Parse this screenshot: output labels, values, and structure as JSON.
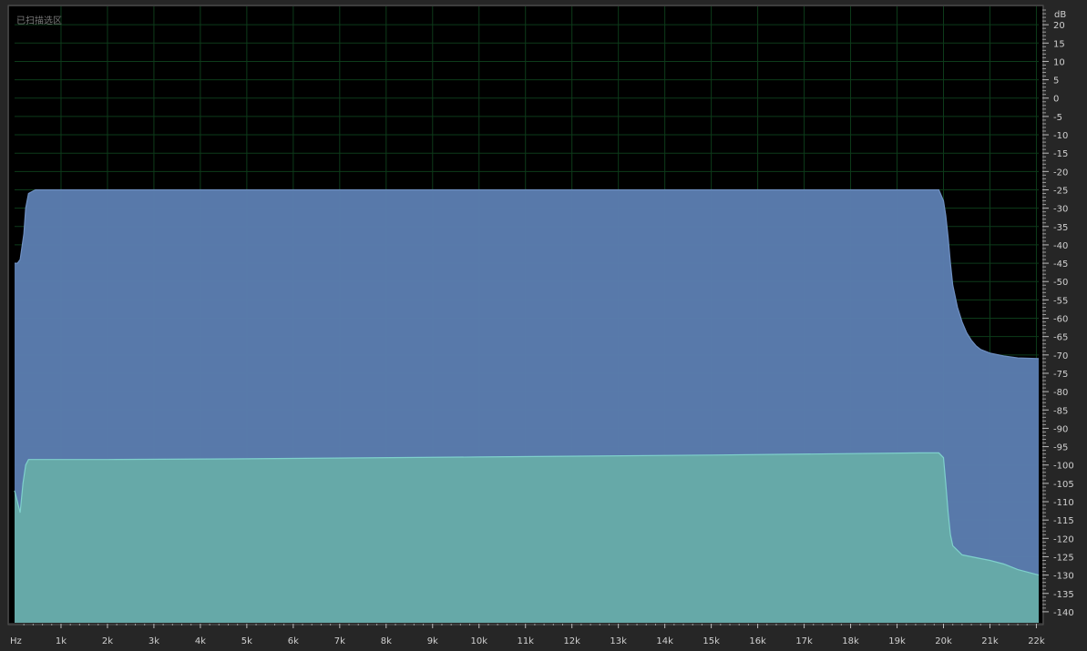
{
  "panel": {
    "status_text": "已扫描选区"
  },
  "colors": {
    "background": "#262626",
    "plot_background": "#000000",
    "grid": "#0d3b1a",
    "channel_1_fill": "#5b7db0",
    "channel_2_fill": "#66aaa8",
    "channel_2_line": "#7fd0cc",
    "tick_text": "#d0d0d0"
  },
  "chart_data": {
    "type": "area",
    "title": "",
    "xlabel": "",
    "ylabel": "",
    "x_unit_label": "Hz",
    "y_unit_label": "dB",
    "xlim": [
      0,
      22050
    ],
    "ylim": [
      -143,
      25
    ],
    "grid": true,
    "x_ticks": [
      {
        "value": 1000,
        "label": "1k"
      },
      {
        "value": 2000,
        "label": "2k"
      },
      {
        "value": 3000,
        "label": "3k"
      },
      {
        "value": 4000,
        "label": "4k"
      },
      {
        "value": 5000,
        "label": "5k"
      },
      {
        "value": 6000,
        "label": "6k"
      },
      {
        "value": 7000,
        "label": "7k"
      },
      {
        "value": 8000,
        "label": "8k"
      },
      {
        "value": 9000,
        "label": "9k"
      },
      {
        "value": 10000,
        "label": "10k"
      },
      {
        "value": 11000,
        "label": "11k"
      },
      {
        "value": 12000,
        "label": "12k"
      },
      {
        "value": 13000,
        "label": "13k"
      },
      {
        "value": 14000,
        "label": "14k"
      },
      {
        "value": 15000,
        "label": "15k"
      },
      {
        "value": 16000,
        "label": "16k"
      },
      {
        "value": 17000,
        "label": "17k"
      },
      {
        "value": 18000,
        "label": "18k"
      },
      {
        "value": 19000,
        "label": "19k"
      },
      {
        "value": 20000,
        "label": "20k"
      },
      {
        "value": 21000,
        "label": "21k"
      },
      {
        "value": 22000,
        "label": "22k"
      }
    ],
    "y_ticks": [
      {
        "value": 20,
        "label": "20"
      },
      {
        "value": 15,
        "label": "15"
      },
      {
        "value": 10,
        "label": "10"
      },
      {
        "value": 5,
        "label": "5"
      },
      {
        "value": 0,
        "label": "0"
      },
      {
        "value": -5,
        "label": "-5"
      },
      {
        "value": -10,
        "label": "-10"
      },
      {
        "value": -15,
        "label": "-15"
      },
      {
        "value": -20,
        "label": "-20"
      },
      {
        "value": -25,
        "label": "-25"
      },
      {
        "value": -30,
        "label": "-30"
      },
      {
        "value": -35,
        "label": "-35"
      },
      {
        "value": -40,
        "label": "-40"
      },
      {
        "value": -45,
        "label": "-45"
      },
      {
        "value": -50,
        "label": "-50"
      },
      {
        "value": -55,
        "label": "-55"
      },
      {
        "value": -60,
        "label": "-60"
      },
      {
        "value": -65,
        "label": "-65"
      },
      {
        "value": -70,
        "label": "-70"
      },
      {
        "value": -75,
        "label": "-75"
      },
      {
        "value": -80,
        "label": "-80"
      },
      {
        "value": -85,
        "label": "-85"
      },
      {
        "value": -90,
        "label": "-90"
      },
      {
        "value": -95,
        "label": "-95"
      },
      {
        "value": -100,
        "label": "-100"
      },
      {
        "value": -105,
        "label": "-105"
      },
      {
        "value": -110,
        "label": "-110"
      },
      {
        "value": -115,
        "label": "-115"
      },
      {
        "value": -120,
        "label": "-120"
      },
      {
        "value": -125,
        "label": "-125"
      },
      {
        "value": -130,
        "label": "-130"
      },
      {
        "value": -135,
        "label": "-135"
      },
      {
        "value": -140,
        "label": "-140"
      }
    ],
    "series": [
      {
        "fill": "#5b7db0",
        "x": [
          0,
          60,
          120,
          200,
          240,
          300,
          450,
          700,
          2000,
          5000,
          10000,
          15000,
          19500,
          19900,
          20000,
          20050,
          20100,
          20150,
          20200,
          20300,
          20400,
          20500,
          20600,
          20700,
          20800,
          21000,
          21300,
          21600,
          22050
        ],
        "y": [
          -45,
          -45,
          -44,
          -37,
          -30,
          -26,
          -25,
          -25,
          -25,
          -25,
          -25,
          -25,
          -25,
          -25,
          -28,
          -32,
          -38,
          -45,
          -51,
          -57,
          -61,
          -64,
          -66,
          -67.5,
          -68.5,
          -69.5,
          -70.3,
          -70.8,
          -71
        ]
      },
      {
        "fill": "#66aaa8",
        "x": [
          0,
          60,
          120,
          180,
          240,
          300,
          700,
          2000,
          5000,
          10000,
          15000,
          19500,
          19900,
          20000,
          20050,
          20100,
          20150,
          20200,
          20400,
          20800,
          21000,
          21300,
          21600,
          22050
        ],
        "y": [
          -107,
          -110,
          -113,
          -105,
          -100,
          -98.5,
          -98.5,
          -98.5,
          -98.3,
          -97.8,
          -97.3,
          -96.7,
          -96.7,
          -98,
          -105,
          -113,
          -119,
          -122,
          -124.5,
          -125.5,
          -126,
          -127,
          -128.5,
          -130
        ]
      }
    ]
  }
}
